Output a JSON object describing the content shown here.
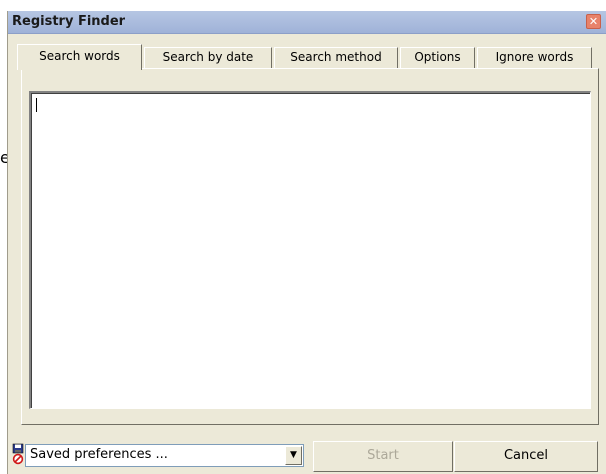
{
  "window": {
    "title": "Registry Finder",
    "close_glyph": "✕"
  },
  "tabs": [
    {
      "label": "Search words",
      "active": true
    },
    {
      "label": "Search by date",
      "active": false
    },
    {
      "label": "Search method",
      "active": false
    },
    {
      "label": "Options",
      "active": false
    },
    {
      "label": "Ignore words",
      "active": false
    }
  ],
  "search_words": {
    "value": ""
  },
  "bottom": {
    "preferences_select_value": "Saved preferences ...",
    "dropdown_glyph": "▼",
    "start_label": "Start",
    "cancel_label": "Cancel"
  },
  "background": {
    "edge_fragment": "e"
  },
  "colors": {
    "window_bg": "#ece9d8",
    "titlebar": "#9fb2d8",
    "close_button": "#e8826a",
    "disabled_text": "#aca899"
  },
  "icons": {
    "preferences": "saved-preferences-icon",
    "close": "close-icon",
    "dropdown": "chevron-down-icon"
  }
}
